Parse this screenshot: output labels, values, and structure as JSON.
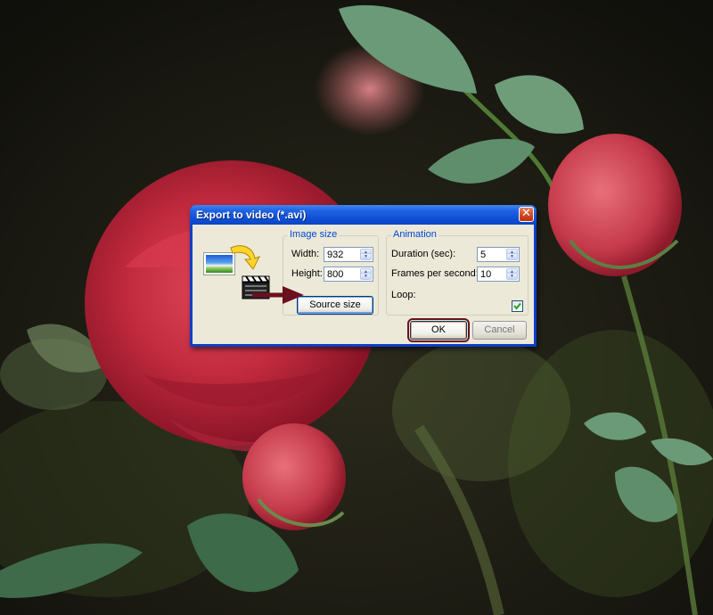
{
  "dialog": {
    "title": "Export to video (*.avi)",
    "close_glyph": "✕",
    "icons": [
      "picture-icon",
      "curved-arrow-icon",
      "clapperboard-icon"
    ]
  },
  "image_size": {
    "label": "Image size",
    "width_label": "Width:",
    "width_value": "932",
    "height_label": "Height:",
    "height_value": "800",
    "source_size_label": "Source size"
  },
  "animation": {
    "label": "Animation",
    "duration_label": "Duration (sec):",
    "duration_value": "5",
    "fps_label": "Frames per second:",
    "fps_value": "10",
    "loop_label": "Loop:",
    "loop_checked": true
  },
  "buttons": {
    "ok_label": "OK",
    "cancel_label": "Cancel"
  },
  "colors": {
    "titlebar": "#0a44c4",
    "group_label": "#0046d5",
    "annotation_arrow": "#6b1020",
    "checkmark": "#21a121"
  }
}
